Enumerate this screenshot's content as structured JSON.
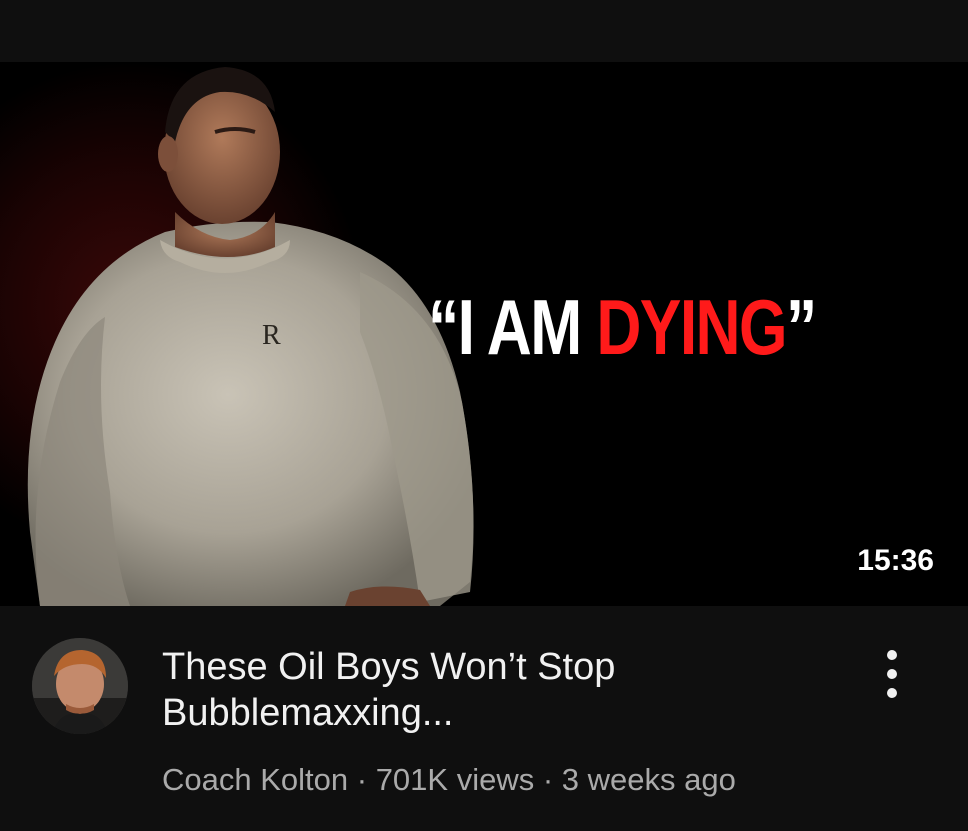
{
  "video": {
    "thumbnail": {
      "headline_open": "“I AM ",
      "headline_red": "DYING",
      "headline_close": "”",
      "duration": "15:36",
      "shirt_logo_icon": "dior-logo-icon",
      "colors": {
        "background": "#000000",
        "headline_white": "#ffffff",
        "headline_red": "#ff1a1a"
      }
    },
    "title_line1": "These Oil Boys Won’t Stop",
    "title_line2": "Bubblemaxxing...",
    "channel": "Coach Kolton",
    "separator1": " · ",
    "views": "701K views",
    "separator2": " · ",
    "age": "3 weeks ago",
    "menu_icon": "more-vertical-icon",
    "avatar_icon": "channel-avatar-icon"
  },
  "theme": {
    "page_bg": "#0f0f0f",
    "title_color": "#f1f1f1",
    "meta_color": "#aaaaaa"
  }
}
